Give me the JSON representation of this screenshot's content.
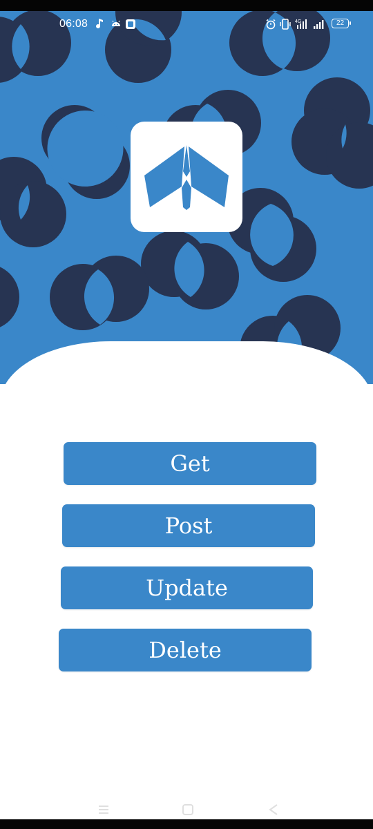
{
  "colors": {
    "brand_blue": "#3a87c9",
    "pattern_navy": "#273452",
    "sheet_white": "#ffffff",
    "status_text": "#ffffff"
  },
  "status_bar": {
    "time": "06:08",
    "network_type": "4G",
    "battery_level": "22",
    "icons": [
      "music-note-icon",
      "android-icon",
      "square-app-icon",
      "alarm-icon",
      "vibrate-icon",
      "signal-4g-icon",
      "signal-icon",
      "battery-icon"
    ]
  },
  "header": {
    "logo_icon": "paper-plane-logo-icon"
  },
  "actions": [
    {
      "label": "Get"
    },
    {
      "label": "Post"
    },
    {
      "label": "Update"
    },
    {
      "label": "Delete"
    }
  ],
  "nav_bar": {
    "icons": [
      "menu-icon",
      "home-icon",
      "back-icon"
    ]
  }
}
